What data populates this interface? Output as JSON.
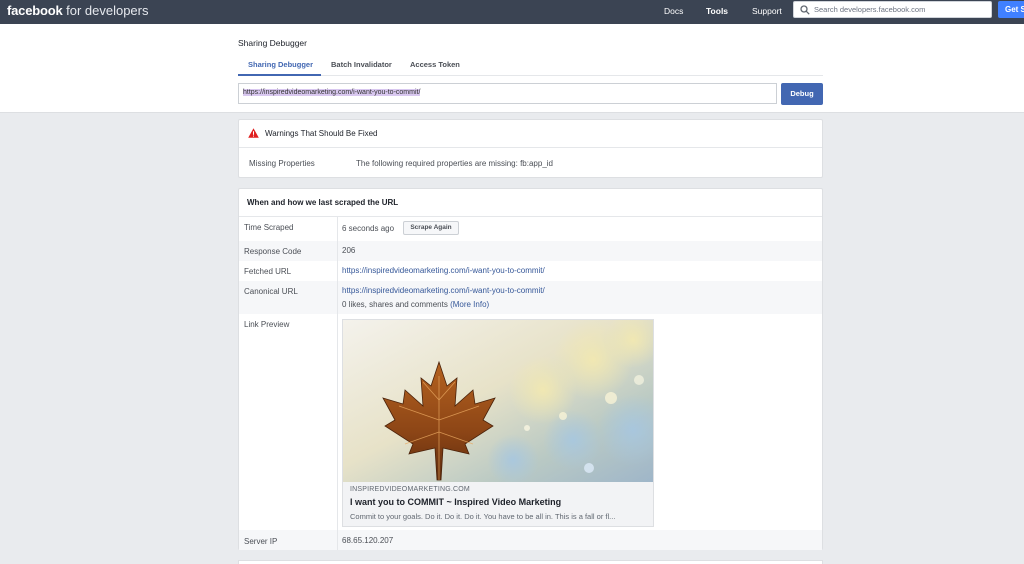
{
  "nav": {
    "brand_bold": "facebook",
    "brand_rest": "for developers",
    "links": [
      "Docs",
      "Tools",
      "Support"
    ],
    "search_placeholder": "Search developers.facebook.com",
    "cta": "Get S"
  },
  "page": {
    "title": "Sharing Debugger",
    "tabs": [
      "Sharing Debugger",
      "Batch Invalidator",
      "Access Token"
    ],
    "url_value": "https://inspiredvideomarketing.com/i-want-you-to-commit/",
    "debug_button": "Debug"
  },
  "warnings": {
    "title": "Warnings That Should Be Fixed",
    "label": "Missing Properties",
    "text": "The following required properties are missing: fb:app_id"
  },
  "scrape": {
    "title": "When and how we last scraped the URL",
    "time_label": "Time Scraped",
    "time_value": "6 seconds ago",
    "scrape_again": "Scrape Again",
    "response_label": "Response Code",
    "response_value": "206",
    "fetched_label": "Fetched URL",
    "fetched_value": "https://inspiredvideomarketing.com/i-want-you-to-commit/",
    "canonical_label": "Canonical URL",
    "canonical_value": "https://inspiredvideomarketing.com/i-want-you-to-commit/",
    "engagement_text": "0 likes, shares and comments",
    "more_info": "(More Info)",
    "preview_label": "Link Preview",
    "server_label": "Server IP",
    "server_value": "68.65.120.207"
  },
  "preview": {
    "domain": "INSPIREDVIDEOMARKETING.COM",
    "title": "I want you to COMMIT ~ Inspired Video Marketing",
    "description": "Commit to your goals. Do it. Do it. Do it. You have to be all in. This is a fall or fl..."
  },
  "colors": {
    "nav_bg": "#3b4453",
    "accent": "#4267b2",
    "cta": "#4080ff",
    "warning_red": "#e02020",
    "link": "#365899"
  }
}
